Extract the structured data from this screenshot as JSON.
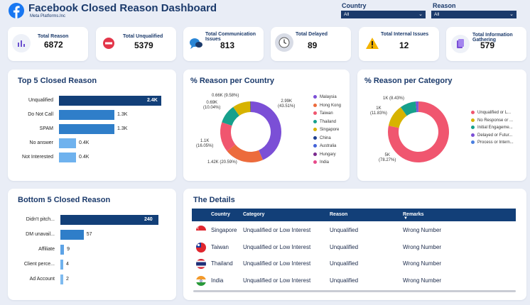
{
  "header": {
    "title": "Facebook Closed Reason Dashboard",
    "subtitle": "Meta Platforms.Inc",
    "logo_icon": "facebook-logo-icon",
    "brand_color": "#1877f2"
  },
  "filters": {
    "country": {
      "label": "Country",
      "value": "All"
    },
    "reason": {
      "label": "Reason",
      "value": "All"
    }
  },
  "kpis": [
    {
      "label_lines": [
        "Total Reason"
      ],
      "value": "6872",
      "icon": "bar-chart-icon"
    },
    {
      "label_lines": [
        "Total Unqualified"
      ],
      "value": "5379",
      "icon": "no-entry-icon"
    },
    {
      "label_lines": [
        "Total Communication",
        "Issues"
      ],
      "value": "813",
      "icon": "chat-icon"
    },
    {
      "label_lines": [
        "Total Delayed"
      ],
      "value": "89",
      "icon": "clock-icon"
    },
    {
      "label_lines": [
        "Total Internal Issues"
      ],
      "value": "12",
      "icon": "warning-icon"
    },
    {
      "label_lines": [
        "Total Information",
        "Gathering"
      ],
      "value": "579",
      "icon": "document-icon"
    }
  ],
  "top5": {
    "title": "Top 5 Closed Reason",
    "chart_data": {
      "type": "bar",
      "orientation": "horizontal",
      "categories": [
        "Unqualified",
        "Do Not Call",
        "SPAM",
        "No answer",
        "Not Interested"
      ],
      "values": [
        2400,
        1300,
        1300,
        400,
        400
      ],
      "value_labels": [
        "2.4K",
        "1.3K",
        "1.3K",
        "0.4K",
        "0.4K"
      ],
      "colors": [
        "#123f78",
        "#2f7ec9",
        "#2f7ec9",
        "#6fb2ee",
        "#6fb2ee"
      ]
    }
  },
  "bottom5": {
    "title": "Bottom 5 Closed Reason",
    "chart_data": {
      "type": "bar",
      "orientation": "horizontal",
      "categories": [
        "Didn't pitch...",
        "DM unavail...",
        "Affiliate",
        "Client perce...",
        "Ad Account"
      ],
      "values": [
        240,
        57,
        9,
        4,
        2
      ],
      "value_labels": [
        "240",
        "57",
        "9",
        "4",
        "2"
      ],
      "colors": [
        "#123f78",
        "#2f7ec9",
        "#5da3e6",
        "#6fb2ee",
        "#7fbbf0"
      ]
    }
  },
  "country_donut": {
    "title": "% Reason per Country",
    "chart_data": {
      "type": "pie",
      "style": "donut",
      "legend_position": "right",
      "slices": [
        {
          "name": "Malaysia",
          "value": 43.51,
          "label": "2.99K\n(43.51%)",
          "color": "#7b4fd6"
        },
        {
          "name": "Hong Kong",
          "value": 20.59,
          "label": "1.42K (20.59%)",
          "color": "#ec6b3c"
        },
        {
          "name": "Taiwan",
          "value": 16.05,
          "label": "1.1K\n(16.05%)",
          "color": "#f0566f"
        },
        {
          "name": "Thailand",
          "value": 10.04,
          "label": "0.69K\n(10.04%)",
          "color": "#16a08c"
        },
        {
          "name": "Singapore",
          "value": 9.58,
          "label": "0.66K (9.58%)",
          "color": "#d7b300"
        },
        {
          "name": "China",
          "value": 0.23,
          "label": "",
          "color": "#1f3f8f"
        },
        {
          "name": "Australia",
          "value": 0.0,
          "label": "",
          "color": "#4463d8"
        },
        {
          "name": "Hungary",
          "value": 0.0,
          "label": "",
          "color": "#7a2a8e"
        },
        {
          "name": "India",
          "value": 0.0,
          "label": "",
          "color": "#e84a8a"
        }
      ]
    }
  },
  "category_donut": {
    "title": "% Reason per Category",
    "chart_data": {
      "type": "pie",
      "style": "donut",
      "legend_position": "right",
      "slices": [
        {
          "name": "Unqualified or L...",
          "value": 78.27,
          "label": "5K\n(78.27%)",
          "color": "#f0566f"
        },
        {
          "name": "No Response or ...",
          "value": 11.83,
          "label": "1K\n(11.83%)",
          "color": "#d7b300"
        },
        {
          "name": "Initial Engageme...",
          "value": 8.43,
          "label": "1K (8.43%)",
          "color": "#16a08c"
        },
        {
          "name": "Delayed or Futur...",
          "value": 1.3,
          "label": "",
          "color": "#7b4fd6"
        },
        {
          "name": "Process or Intern...",
          "value": 0.17,
          "label": "",
          "color": "#4a7fe0"
        }
      ]
    }
  },
  "details": {
    "title": "The Details",
    "columns": [
      "Country",
      "Category",
      "Reason",
      "Remarks"
    ],
    "rows": [
      {
        "flag": "singapore-flag-icon",
        "country": "Singapore",
        "category": "Unqualified or Low Interest",
        "reason": "Unqualified",
        "remarks": "Wrong Number"
      },
      {
        "flag": "taiwan-flag-icon",
        "country": "Taiwan",
        "category": "Unqualified or Low Interest",
        "reason": "Unqualified",
        "remarks": "Wrong Number"
      },
      {
        "flag": "thailand-flag-icon",
        "country": "Thailand",
        "category": "Unqualified or Low Interest",
        "reason": "Unqualified",
        "remarks": "Wrong Number"
      },
      {
        "flag": "india-flag-icon",
        "country": "India",
        "category": "Unqualified or Low Interest",
        "reason": "Unqualified",
        "remarks": "Wrong Number"
      }
    ]
  }
}
